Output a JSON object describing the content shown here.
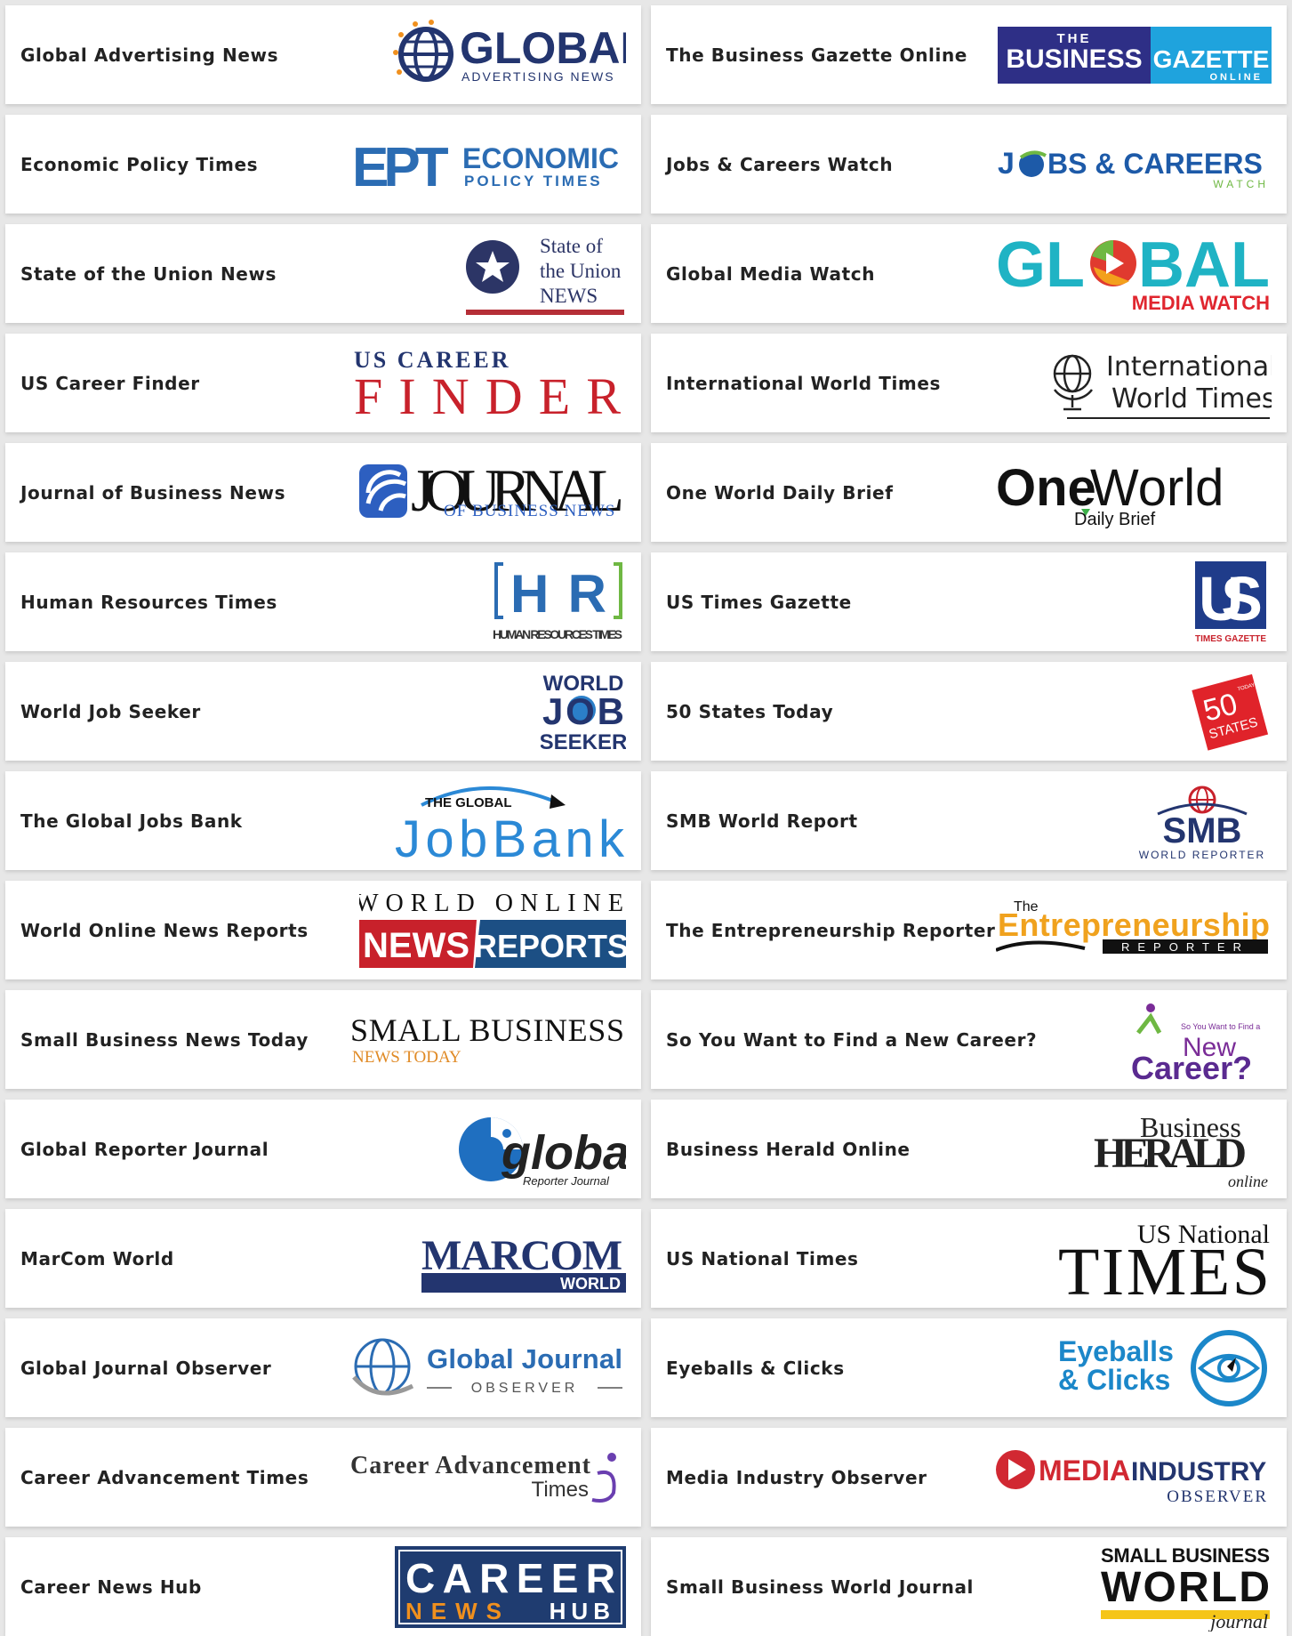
{
  "cards": [
    {
      "name": "Global Advertising News",
      "logo": [
        "GLOBAL",
        "ADVERTISING NEWS"
      ]
    },
    {
      "name": "The Business Gazette Online",
      "logo": [
        "THE",
        "BUSINESS",
        "GAZETTE",
        "ONLINE"
      ]
    },
    {
      "name": "Economic Policy Times",
      "logo": [
        "EPT",
        "ECONOMIC",
        "POLICY TIMES"
      ]
    },
    {
      "name": "Jobs & Careers Watch",
      "logo": [
        "J",
        "BS & CAREERS",
        "WATCH"
      ]
    },
    {
      "name": "State of the Union News",
      "logo": [
        "State of",
        "the Union",
        "NEWS"
      ]
    },
    {
      "name": "Global Media Watch",
      "logo": [
        "GL",
        "BAL",
        "MEDIA WATCH"
      ]
    },
    {
      "name": "US Career Finder",
      "logo": [
        "US CAREER",
        "FINDER"
      ]
    },
    {
      "name": "International World Times",
      "logo": [
        "International",
        "World Times"
      ]
    },
    {
      "name": "Journal of Business News",
      "logo": [
        "JOURNAL",
        "OF BUSINESS NEWS"
      ]
    },
    {
      "name": "One World Daily Brief",
      "logo": [
        "One",
        "World",
        "Daily Brief"
      ]
    },
    {
      "name": "Human Resources Times",
      "logo": [
        "HR",
        "HUMAN RESOURCES TIMES"
      ]
    },
    {
      "name": "US Times Gazette",
      "logo": [
        "US",
        "TIMES GAZETTE"
      ]
    },
    {
      "name": "World Job Seeker",
      "logo": [
        "WORLD",
        "JOB",
        "SEEKER"
      ]
    },
    {
      "name": "50 States Today",
      "logo": [
        "50",
        "STATES",
        "TODAY"
      ]
    },
    {
      "name": "The Global Jobs Bank",
      "logo": [
        "THE GLOBAL",
        "JobBank"
      ]
    },
    {
      "name": "SMB World Report",
      "logo": [
        "SMB",
        "WORLD REPORTER"
      ]
    },
    {
      "name": "World Online News Reports",
      "logo": [
        "WORLD ONLINE",
        "NEWS",
        "REPORTS"
      ]
    },
    {
      "name": "The Entrepreneurship Reporter",
      "logo": [
        "The",
        "Entrepreneurship",
        "REPORTER"
      ]
    },
    {
      "name": "Small Business News Today",
      "logo": [
        "SMALL BUSINESS",
        "NEWS TODAY"
      ]
    },
    {
      "name": "So You Want to Find a New Career?",
      "logo": [
        "So You Want to Find a",
        "New",
        "Career?"
      ]
    },
    {
      "name": "Global Reporter Journal",
      "logo": [
        "global",
        "Reporter Journal"
      ]
    },
    {
      "name": "Business Herald Online",
      "logo": [
        "Business",
        "HERALD",
        "online"
      ]
    },
    {
      "name": "MarCom World",
      "logo": [
        "MARCOM",
        "WORLD"
      ]
    },
    {
      "name": "US National Times",
      "logo": [
        "US National",
        "TIMES"
      ]
    },
    {
      "name": "Global Journal Observer",
      "logo": [
        "Global Journal",
        "OBSERVER"
      ]
    },
    {
      "name": "Eyeballs & Clicks",
      "logo": [
        "Eyeballs",
        "& Clicks"
      ]
    },
    {
      "name": "Career Advancement Times",
      "logo": [
        "Career Advancement",
        "Times"
      ]
    },
    {
      "name": "Media Industry Observer",
      "logo": [
        "MEDIA",
        "INDUSTRY",
        "OBSERVER"
      ]
    },
    {
      "name": "Career News Hub",
      "logo": [
        "CAREER",
        "NEWS",
        "HUB"
      ]
    },
    {
      "name": "Small Business World Journal",
      "logo": [
        "SMALL BUSINESS",
        "WORLD",
        "journal"
      ]
    }
  ],
  "colors": {
    "navy": "#23356f",
    "blue": "#2b6cb3",
    "teal": "#25a9c7",
    "green": "#6fb843",
    "red": "#c8212b",
    "orange": "#f0901e",
    "black": "#111111"
  }
}
